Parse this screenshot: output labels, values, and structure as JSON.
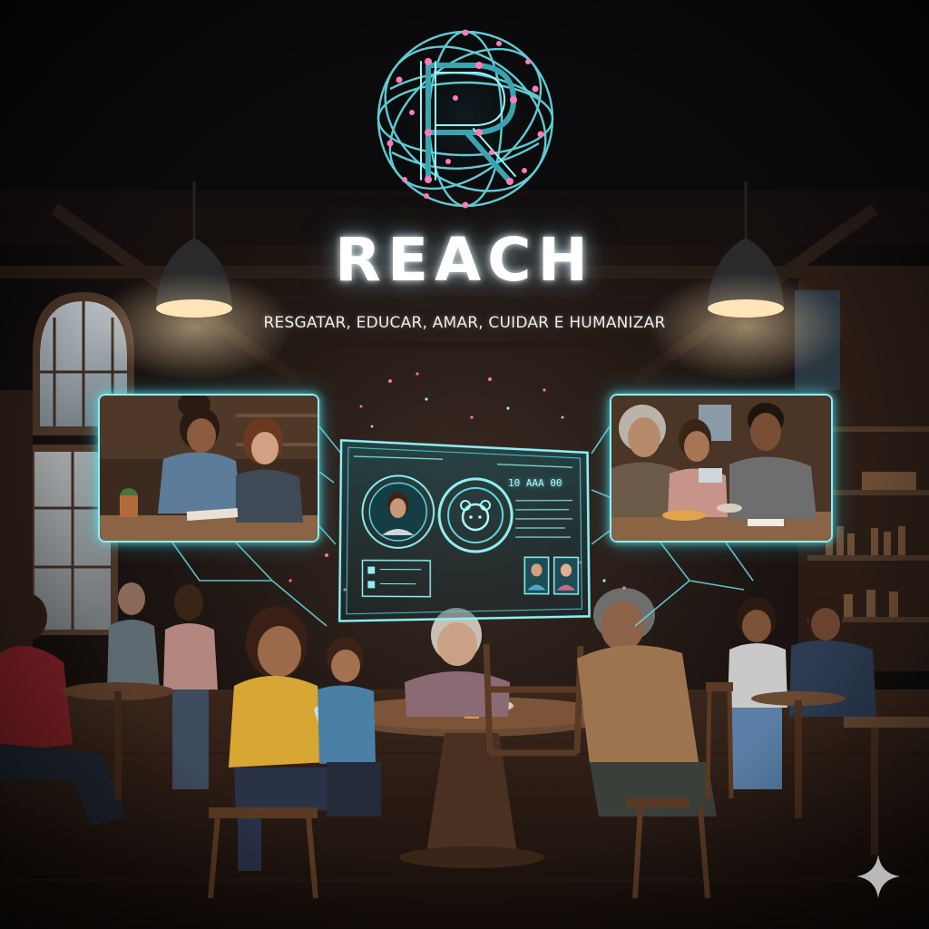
{
  "brand": {
    "name": "REACH",
    "tagline": "RESGATAR, EDUCAR, AMAR, CUIDAR E HUMANIZAR"
  },
  "dashboard": {
    "code": "10 AAA 00"
  },
  "icons": {
    "logo": "r-network-globe-logo",
    "profile": "avatar-icon",
    "bear": "bear-icon",
    "corner": "sparkle-icon"
  },
  "colors": {
    "background": "#0c0a0b",
    "accent_cyan": "#8ff0f4",
    "accent_pink": "#ff6fae",
    "title_glow": "#bfefff"
  }
}
